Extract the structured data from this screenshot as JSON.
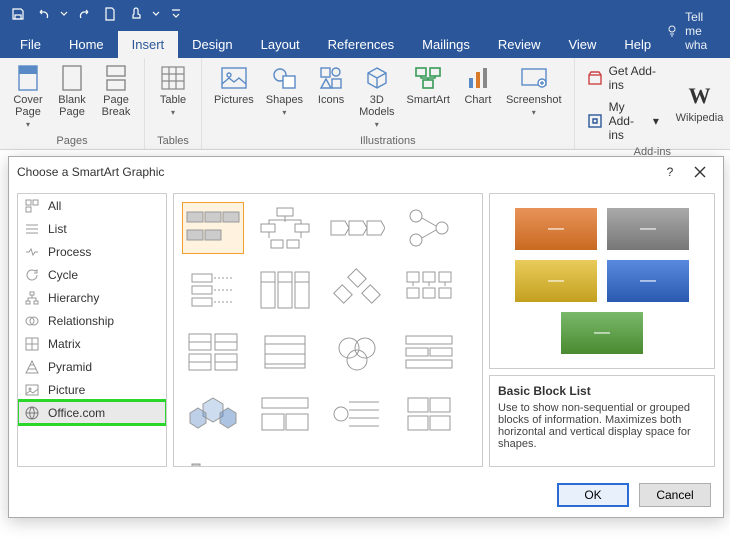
{
  "qat": {
    "items": [
      "save",
      "undo",
      "redo",
      "new",
      "touch",
      "more"
    ]
  },
  "tabs": [
    "File",
    "Home",
    "Insert",
    "Design",
    "Layout",
    "References",
    "Mailings",
    "Review",
    "View",
    "Help"
  ],
  "active_tab_index": 2,
  "tellme": "Tell me wha",
  "ribbon": {
    "pages": {
      "label": "Pages",
      "cover": "Cover\nPage",
      "blank": "Blank\nPage",
      "break": "Page\nBreak"
    },
    "tables": {
      "label": "Tables",
      "table": "Table"
    },
    "illus": {
      "label": "Illustrations",
      "pictures": "Pictures",
      "shapes": "Shapes",
      "icons": "Icons",
      "models": "3D\nModels",
      "smartart": "SmartArt",
      "chart": "Chart",
      "screenshot": "Screenshot"
    },
    "addins": {
      "label": "Add-ins",
      "get": "Get Add-ins",
      "my": "My Add-ins",
      "wiki": "Wikipedia"
    }
  },
  "dialog": {
    "title": "Choose a SmartArt Graphic",
    "categories": [
      "All",
      "List",
      "Process",
      "Cycle",
      "Hierarchy",
      "Relationship",
      "Matrix",
      "Pyramid",
      "Picture",
      "Office.com"
    ],
    "highlight_index": 9,
    "preview": {
      "title": "Basic Block List",
      "desc": "Use to show non-sequential or grouped blocks of information. Maximizes both horizontal and vertical display space for shapes.",
      "colors": [
        "#d87a2a",
        "#8c8c8c",
        "#d6b02a",
        "#3a6fc9",
        "#5fa03a"
      ]
    },
    "ok": "OK",
    "cancel": "Cancel"
  }
}
